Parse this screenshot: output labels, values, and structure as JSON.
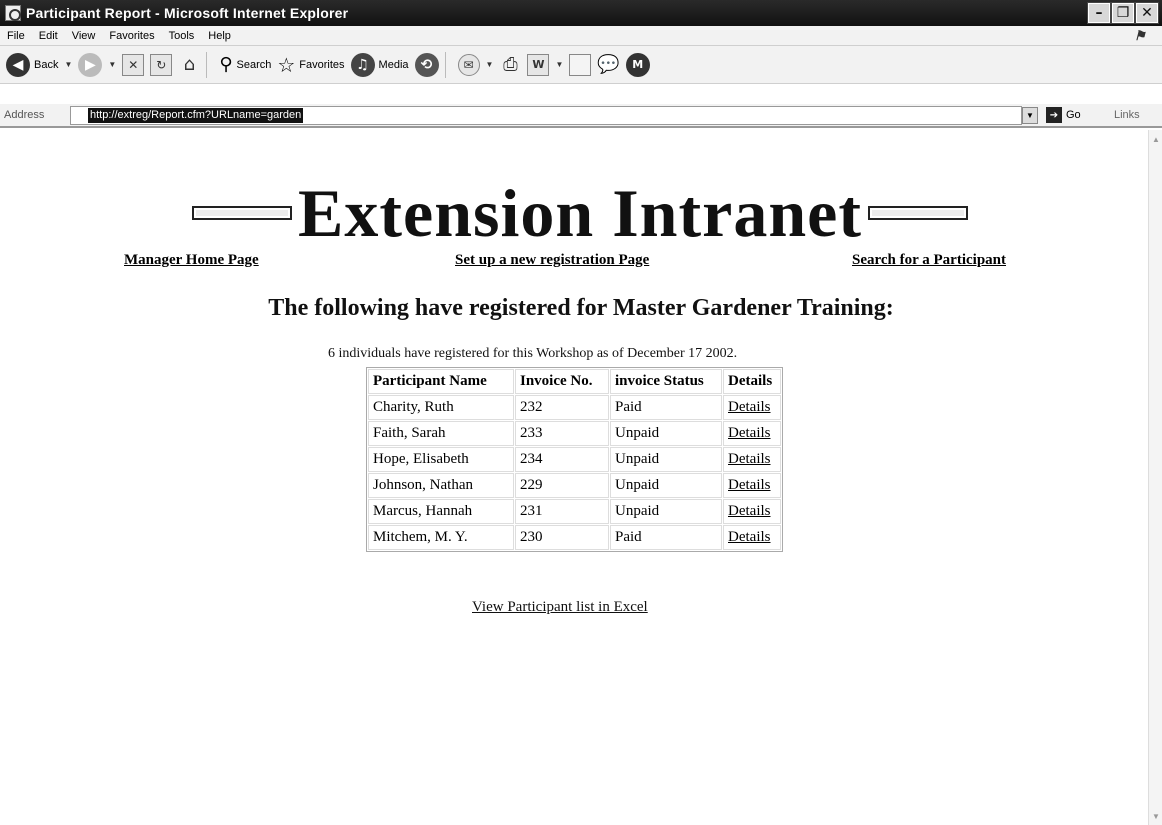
{
  "window": {
    "title": "Participant Report - Microsoft Internet Explorer",
    "buttons": [
      "minimize",
      "maximize",
      "close"
    ]
  },
  "menu": [
    "File",
    "Edit",
    "View",
    "Favorites",
    "Tools",
    "Help"
  ],
  "toolbar": {
    "back_label": "Back",
    "search_label": "Search",
    "favorites_label": "Favorites",
    "media_label": "Media"
  },
  "address": {
    "label": "Address",
    "url": "http://extreg/Report.cfm?URLname=garden",
    "go_label": "Go",
    "links_label": "Links"
  },
  "page": {
    "banner_title": "Extension Intranet",
    "nav": {
      "manager_home": "Manager Home Page",
      "new_registration": "Set up a new registration Page",
      "search_participant": "Search for a Participant"
    },
    "heading": "The following have registered for Master Gardener Training:",
    "count_line": "6 individuals have registered for this Workshop as of December 17 2002.",
    "table": {
      "headers": [
        "Participant Name",
        "Invoice No.",
        "invoice Status",
        "Details"
      ],
      "rows": [
        [
          "Charity, Ruth",
          "232",
          "Paid",
          "Details"
        ],
        [
          "Faith, Sarah",
          "233",
          "Unpaid",
          "Details"
        ],
        [
          "Hope, Elisabeth",
          "234",
          "Unpaid",
          "Details"
        ],
        [
          "Johnson, Nathan",
          "229",
          "Unpaid",
          "Details"
        ],
        [
          "Marcus, Hannah",
          "231",
          "Unpaid",
          "Details"
        ],
        [
          "Mitchem, M. Y.",
          "230",
          "Paid",
          "Details"
        ]
      ]
    },
    "excel_link": "View Participant list in Excel"
  },
  "icons": [
    "ie-page-icon",
    "back-icon",
    "forward-icon",
    "stop-icon",
    "refresh-icon",
    "home-icon",
    "search-icon",
    "favorites-icon",
    "media-icon",
    "history-icon",
    "mail-icon",
    "print-icon",
    "edit-icon",
    "discuss-icon",
    "messenger-icon",
    "go-icon",
    "windows-flag-icon"
  ]
}
